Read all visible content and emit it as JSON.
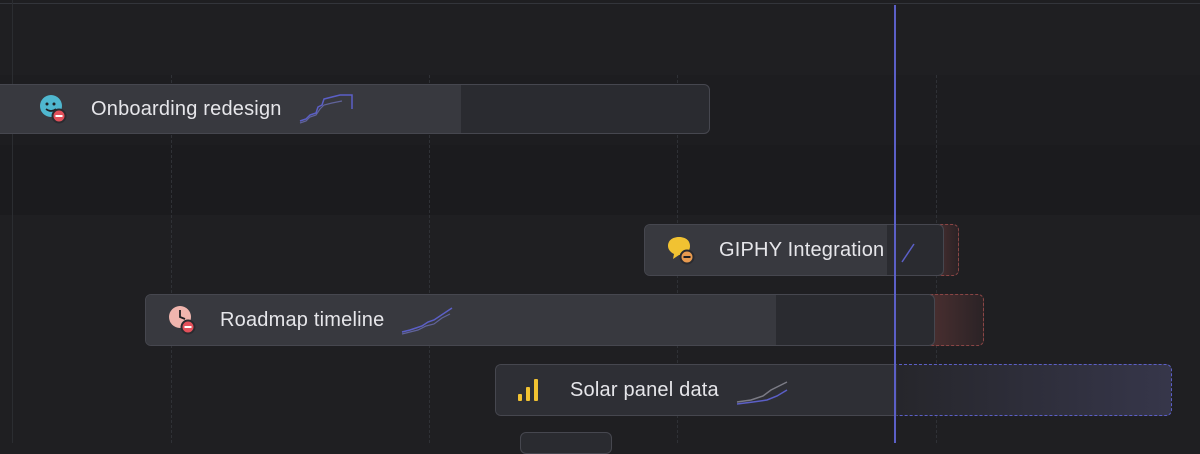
{
  "timeline": {
    "accent": "#5b5fc7",
    "overdue_color": "#7a3f3f",
    "projects": [
      {
        "name": "Onboarding redesign",
        "icon": "onboarding-icon",
        "status": "blocked"
      },
      {
        "name": "GIPHY Integration",
        "icon": "chat-bubble-icon",
        "status": "blocked"
      },
      {
        "name": "Roadmap timeline",
        "icon": "clock-icon",
        "status": "blocked"
      },
      {
        "name": "Solar panel data",
        "icon": "bar-chart-icon",
        "status": "active"
      }
    ]
  }
}
